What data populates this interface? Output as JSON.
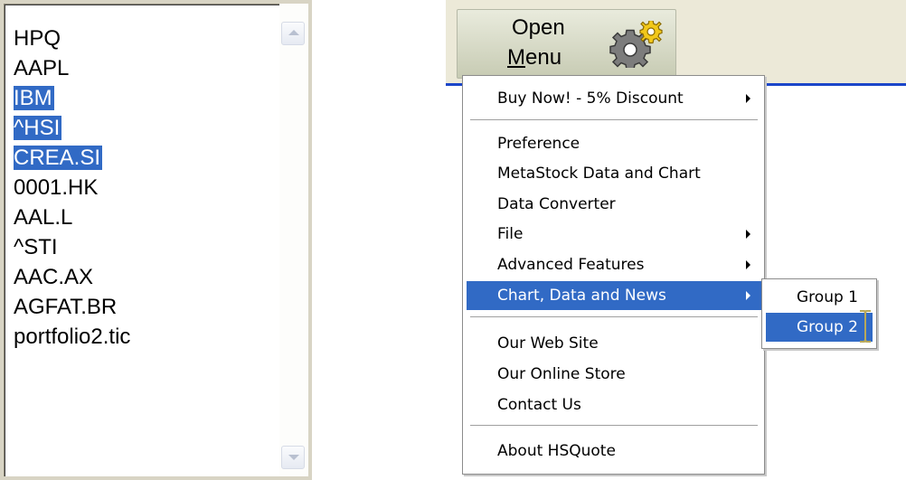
{
  "listbox": {
    "items": [
      {
        "label": "HPQ",
        "selected": false
      },
      {
        "label": "AAPL",
        "selected": false
      },
      {
        "label": "IBM",
        "selected": true
      },
      {
        "label": "^HSI",
        "selected": true
      },
      {
        "label": "CREA.SI",
        "selected": true
      },
      {
        "label": "0001.HK",
        "selected": false
      },
      {
        "label": "AAL.L",
        "selected": false
      },
      {
        "label": "^STI",
        "selected": false
      },
      {
        "label": "AAC.AX",
        "selected": false
      },
      {
        "label": "AGFAT.BR",
        "selected": false
      },
      {
        "label": "portfolio2.tic",
        "selected": false
      }
    ]
  },
  "open_menu_button": {
    "line1": "Open",
    "line2_underlined": "M",
    "line2_rest": "enu",
    "icon": "gear-icon"
  },
  "menu": {
    "items": [
      {
        "label": "Buy Now! - 5% Discount",
        "submenu": true
      },
      {
        "label": "Preference",
        "submenu": false
      },
      {
        "label": "MetaStock Data and Chart",
        "submenu": false
      },
      {
        "label": "Data Converter",
        "submenu": false
      },
      {
        "label": "File",
        "submenu": true
      },
      {
        "label": "Advanced Features",
        "submenu": true
      },
      {
        "label": "Chart, Data and News",
        "submenu": true,
        "highlighted": true
      },
      {
        "label": "Our Web Site",
        "submenu": false
      },
      {
        "label": "Our Online Store",
        "submenu": false
      },
      {
        "label": "Contact Us",
        "submenu": false
      },
      {
        "label": "About HSQuote",
        "submenu": false
      }
    ]
  },
  "submenu": {
    "items": [
      {
        "label": "Group 1",
        "highlighted": false
      },
      {
        "label": "Group 2",
        "highlighted": true
      }
    ]
  },
  "colors": {
    "selection": "#316ac5",
    "window_face": "#ece9d8",
    "accent_line": "#1b46c9"
  }
}
